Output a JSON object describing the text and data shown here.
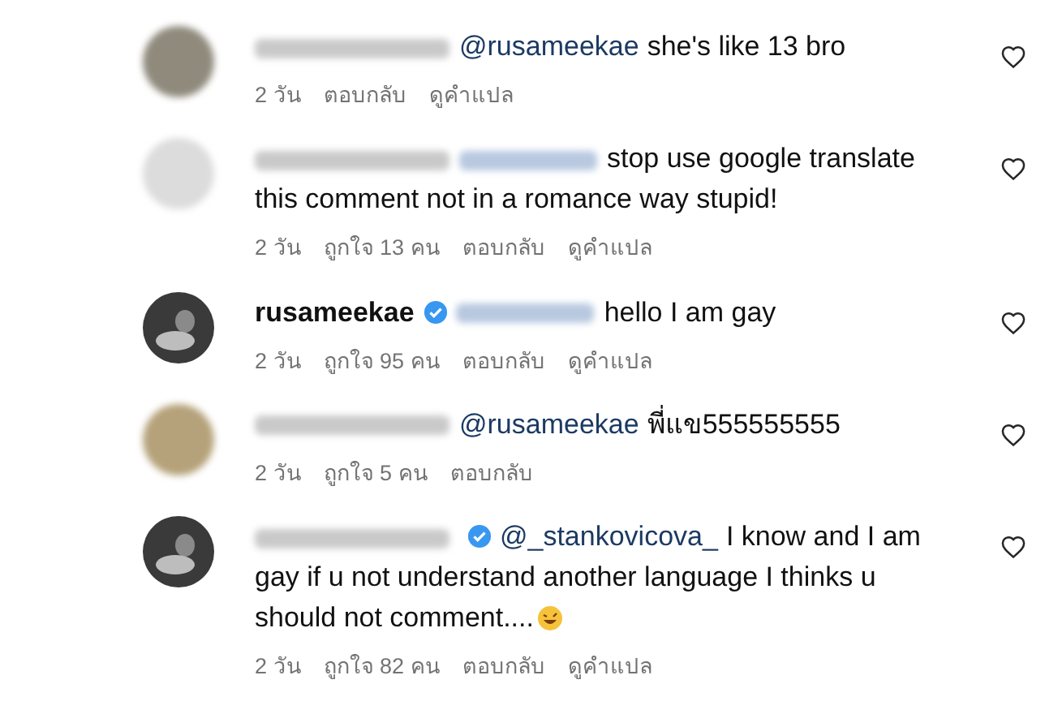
{
  "comments": [
    {
      "avatar": {
        "kind": "blurred",
        "color": "#8f8a7c"
      },
      "author_blurred": true,
      "verified": false,
      "mention": "@rusameekae",
      "mention_blurred": false,
      "text_lines": [
        "she's like 13 bro"
      ],
      "trailing_emoji": false,
      "meta": [
        "2 วัน",
        "ตอบกลับ",
        "ดูคำแปล"
      ]
    },
    {
      "avatar": {
        "kind": "default",
        "color": "#dcdcdc"
      },
      "author_blurred": true,
      "verified": false,
      "mention_blurred": true,
      "text_lines": [
        "stop use google translate",
        "this comment not in a romance way stupid!"
      ],
      "trailing_emoji": false,
      "meta": [
        "2 วัน",
        "ถูกใจ 13 คน",
        "ตอบกลับ",
        "ดูคำแปล"
      ]
    },
    {
      "avatar": {
        "kind": "photo",
        "color": "#3a3a3a"
      },
      "author": "rusameekae",
      "author_blurred": false,
      "verified": true,
      "mention_blurred": true,
      "text_lines": [
        "hello I am gay"
      ],
      "trailing_emoji": false,
      "meta": [
        "2 วัน",
        "ถูกใจ 95 คน",
        "ตอบกลับ",
        "ดูคำแปล"
      ]
    },
    {
      "avatar": {
        "kind": "blurred",
        "color": "#b5a27a"
      },
      "author_blurred": true,
      "verified": false,
      "mention": "@rusameekae",
      "mention_blurred": false,
      "text_lines": [
        "พี่แข555555555"
      ],
      "trailing_emoji": false,
      "meta": [
        "2 วัน",
        "ถูกใจ 5 คน",
        "ตอบกลับ"
      ]
    },
    {
      "avatar": {
        "kind": "photo",
        "color": "#3a3a3a"
      },
      "author_blurred": true,
      "verified": true,
      "mention": "@_stankovicova_",
      "mention_blurred": false,
      "text_lines": [
        "I know and I am",
        "gay if u not understand another language I thinks u",
        "should not comment...."
      ],
      "trailing_emoji": true,
      "meta": [
        "2 วัน",
        "ถูกใจ 82 คน",
        "ตอบกลับ",
        "ดูคำแปล"
      ]
    }
  ]
}
